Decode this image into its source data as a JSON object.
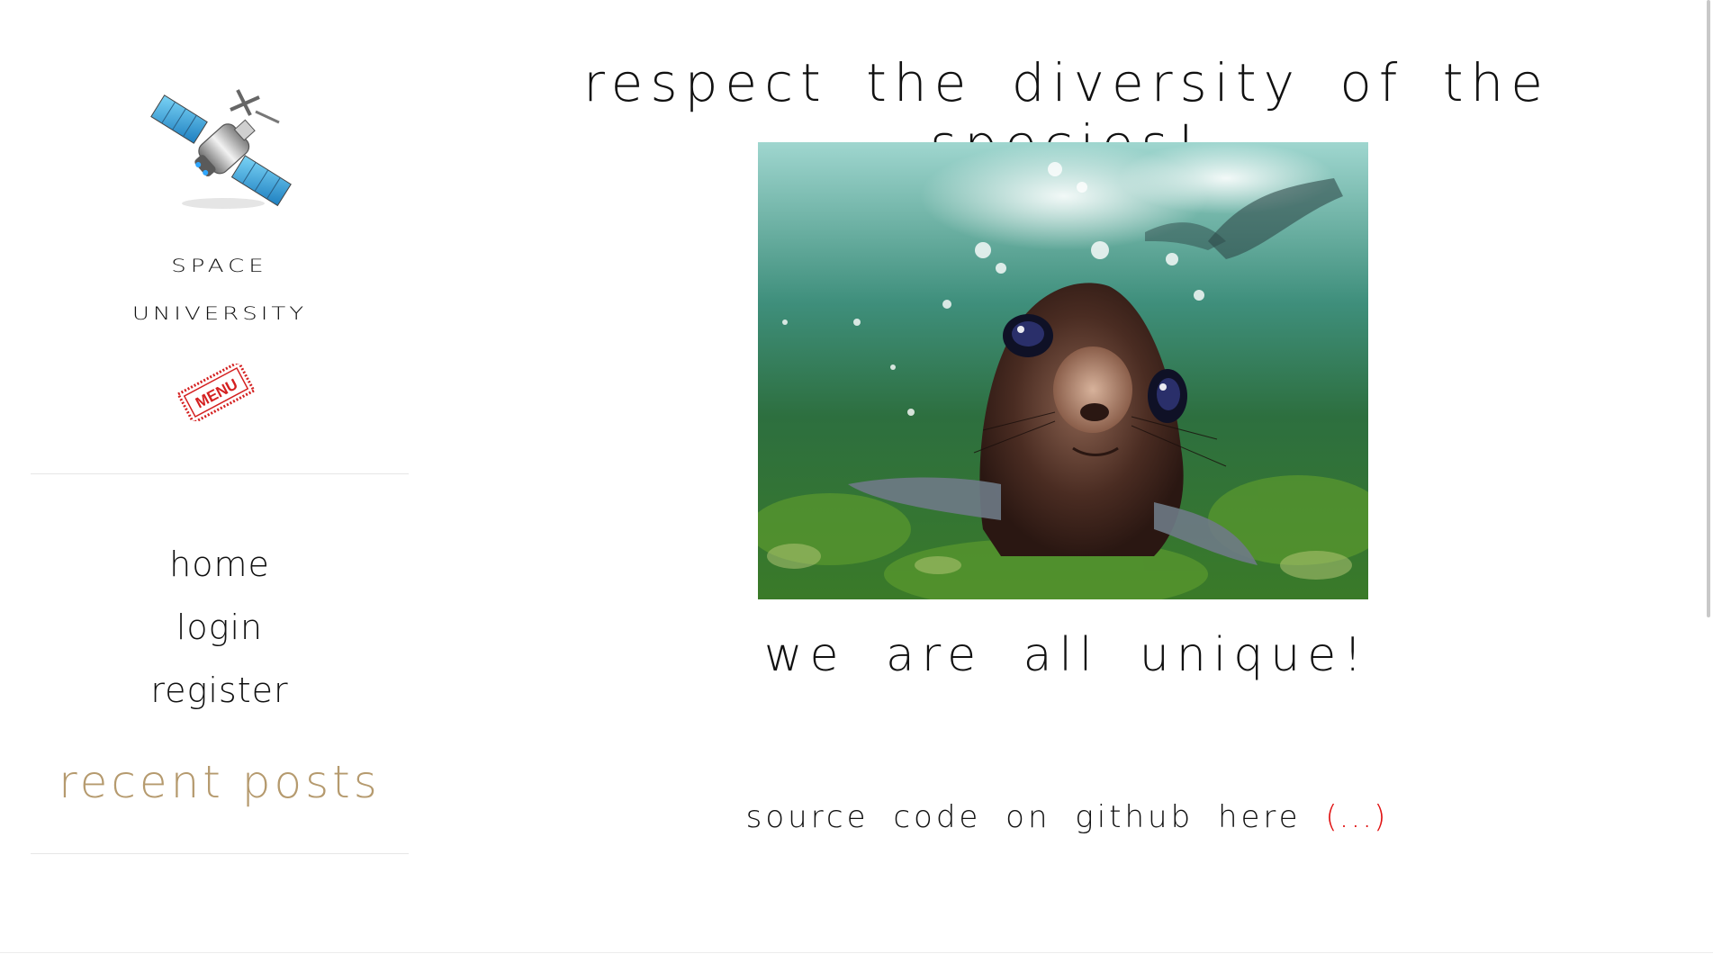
{
  "sidebar": {
    "logo_icon": "satellite-icon",
    "title_line1": "Space",
    "title_line2": "University",
    "menu_stamp_label": "MENU",
    "nav_items": [
      {
        "label": "home"
      },
      {
        "label": "login"
      },
      {
        "label": "register"
      }
    ],
    "recent_posts_label": "recent posts"
  },
  "main": {
    "headline": "respect the diversity of the species!",
    "hero_image_subject": "sea-lion-pup-underwater",
    "tagline": "we are all unique!",
    "source_text": "source code on github here",
    "source_link_label": "(...)"
  },
  "colors": {
    "accent_gold": "#b59a6e",
    "link_red": "#e01010",
    "stamp_red": "#d42020",
    "text": "#111111"
  }
}
